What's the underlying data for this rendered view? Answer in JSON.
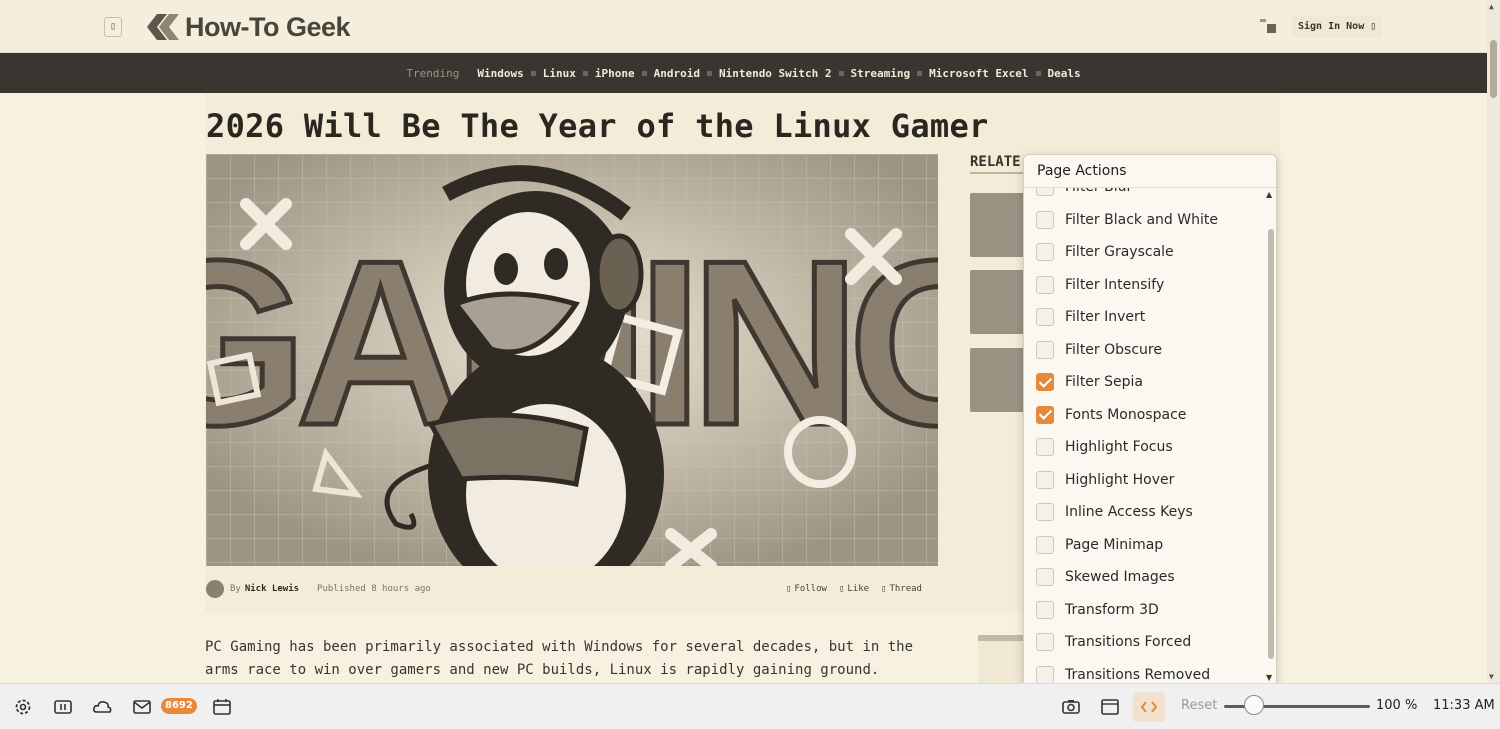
{
  "site": {
    "logo_text": "How-To Geek",
    "signin_label": "Sign In Now"
  },
  "trending": {
    "label": "Trending",
    "links": [
      "Windows",
      "Linux",
      "iPhone",
      "Android",
      "Nintendo Switch 2",
      "Streaming",
      "Microsoft Excel",
      "Deals"
    ]
  },
  "article": {
    "title": "2026 Will Be The Year of the Linux Gamer",
    "hero_word": "GAMING",
    "related_label": "RELATE",
    "byline_prefix": "By",
    "author": "Nick Lewis",
    "published": "Published 8 hours ago",
    "actions": [
      "Follow",
      "Like",
      "Thread"
    ],
    "body": "PC Gaming has been primarily associated with Windows for several decades, but in the arms race to win over gamers and new PC builds, Linux is rapidly gaining ground."
  },
  "panel": {
    "title": "Page Actions",
    "items": [
      {
        "label": "Filter Blur",
        "checked": false
      },
      {
        "label": "Filter Black and White",
        "checked": false
      },
      {
        "label": "Filter Grayscale",
        "checked": false
      },
      {
        "label": "Filter Intensify",
        "checked": false
      },
      {
        "label": "Filter Invert",
        "checked": false
      },
      {
        "label": "Filter Obscure",
        "checked": false
      },
      {
        "label": "Filter Sepia",
        "checked": true
      },
      {
        "label": "Fonts Monospace",
        "checked": true
      },
      {
        "label": "Highlight Focus",
        "checked": false
      },
      {
        "label": "Highlight Hover",
        "checked": false
      },
      {
        "label": "Inline Access Keys",
        "checked": false
      },
      {
        "label": "Page Minimap",
        "checked": false
      },
      {
        "label": "Skewed Images",
        "checked": false
      },
      {
        "label": "Transform 3D",
        "checked": false
      },
      {
        "label": "Transitions Forced",
        "checked": false
      },
      {
        "label": "Transitions Removed",
        "checked": false
      }
    ]
  },
  "statusbar": {
    "mail_count": "8692",
    "reset_label": "Reset",
    "zoom": "100 %",
    "zoom_value": 100,
    "time": "11:33 AM",
    "icons": [
      "settings-icon",
      "panel-icon",
      "cloud-sync-icon",
      "mail-icon",
      "calendar-icon",
      "capture-icon",
      "tiling-icon",
      "page-actions-icon"
    ]
  },
  "colors": {
    "accent": "#e8893a",
    "sepia_bg": "#f7f1e1",
    "trend_bar": "#3a3530"
  }
}
